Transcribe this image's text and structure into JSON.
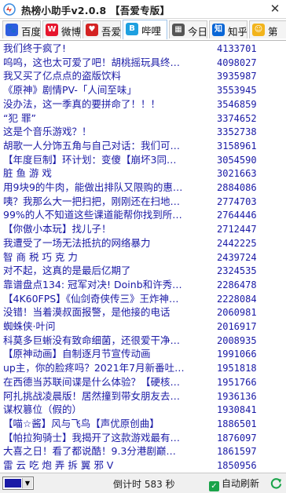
{
  "window": {
    "title": "热榜小助手v2.0.8 【吾爱专版】",
    "close_glyph": "✕"
  },
  "tabs": [
    {
      "label": "百度",
      "icon": "baidu-icon",
      "color": "#2e5ee0",
      "glyph": "🐾"
    },
    {
      "label": "微博",
      "icon": "weibo-icon",
      "color": "#e6162d",
      "glyph": "W"
    },
    {
      "label": "吾爱",
      "icon": "52pojie-icon",
      "color": "#d42222",
      "glyph": "♥"
    },
    {
      "label": "哔哩",
      "icon": "bilibili-icon",
      "color": "#1ea0e0",
      "glyph": "B"
    },
    {
      "label": "今日",
      "icon": "calendar-icon",
      "color": "#555555",
      "glyph": "▦"
    },
    {
      "label": "知乎",
      "icon": "zhihu-icon",
      "color": "#0a66d6",
      "glyph": "知"
    },
    {
      "label": "第",
      "icon": "more-icon",
      "color": "#f2b41c",
      "glyph": "☺"
    }
  ],
  "active_tab": 3,
  "list": [
    {
      "title": "我们终于疯了!",
      "value": "4133701"
    },
    {
      "title": "呜呜，这也太可爱了吧！胡桃摇玩具终…",
      "value": "4098027"
    },
    {
      "title": "我又买了亿点点的盗版饮料",
      "value": "3935987"
    },
    {
      "title": "《原神》剧情PV-「人间至味」",
      "value": "3553945"
    },
    {
      "title": "没办法，这一季真的要拼命了！！！",
      "value": "3546859"
    },
    {
      "title": "“犯 罪”",
      "value": "3374652"
    },
    {
      "title": "这是个音乐游戏？！",
      "value": "3352738"
    },
    {
      "title": "胡歌一人分饰五角与自己对话：我们可…",
      "value": "3158961"
    },
    {
      "title": "【年度巨制】环计划：变傻【崩坏3同…",
      "value": "3054590"
    },
    {
      "title": "脏 鱼 游 戏",
      "value": "3021663"
    },
    {
      "title": "用9块9的牛肉，能做出排队又限购的惠…",
      "value": "2884086"
    },
    {
      "title": "咦？我那么大一把扫把，刚刚还在扫地…",
      "value": "2774703"
    },
    {
      "title": "99%的人不知道这些课道能帮你找到所…",
      "value": "2764446"
    },
    {
      "title": "【你傲小本玩】找儿子！",
      "value": "2712447"
    },
    {
      "title": "我遭受了一场无法抵抗的网络暴力",
      "value": "2442225"
    },
    {
      "title": "智 商 税 巧 克 力",
      "value": "2439724"
    },
    {
      "title": "对不起，这真的是最后亿期了",
      "value": "2324535"
    },
    {
      "title": "靠谱盘点134: 冠军对决! Doinb和许秀…",
      "value": "2286478"
    },
    {
      "title": "【4K60FPS】《仙剑奇侠传三》王炸神…",
      "value": "2228084"
    },
    {
      "title": "没错！当着漠叔面报警，是他接的电话",
      "value": "2060981"
    },
    {
      "title": "蜘蛛侠·叶问",
      "value": "2016917"
    },
    {
      "title": "科莫多巨蜥没有致命细菌，还很爱干净…",
      "value": "2008935"
    },
    {
      "title": "【原神动画】自制逐月节宣传动画",
      "value": "1991066"
    },
    {
      "title": "up主，你的脸疼吗？2021年7月新番吐…",
      "value": "1951818"
    },
    {
      "title": "在西德当苏联间谍是什么体验？【硬核…",
      "value": "1951766"
    },
    {
      "title": "阿扎挑战凌晨版！居然撞到带女朋友去…",
      "value": "1936136"
    },
    {
      "title": "谋权篡位（假的）",
      "value": "1930841"
    },
    {
      "title": "【喵☆酱】风与飞鸟【声优原创曲】",
      "value": "1886501"
    },
    {
      "title": "【帕拉狗骑士】我揭开了这款游戏最有…",
      "value": "1876097"
    },
    {
      "title": "大喜之日！看了都说酷！9.3分港剧巅…",
      "value": "1861597"
    },
    {
      "title": "雷 云 吃 炮 弄 拆 翼 邪 V",
      "value": "1850956"
    }
  ],
  "status": {
    "swatch_color": "#1a1aa6",
    "countdown_label": "倒计时",
    "countdown_value": "583",
    "countdown_unit": "秒",
    "auto_refresh_label": "自动刷新",
    "auto_refresh_checked": true
  }
}
